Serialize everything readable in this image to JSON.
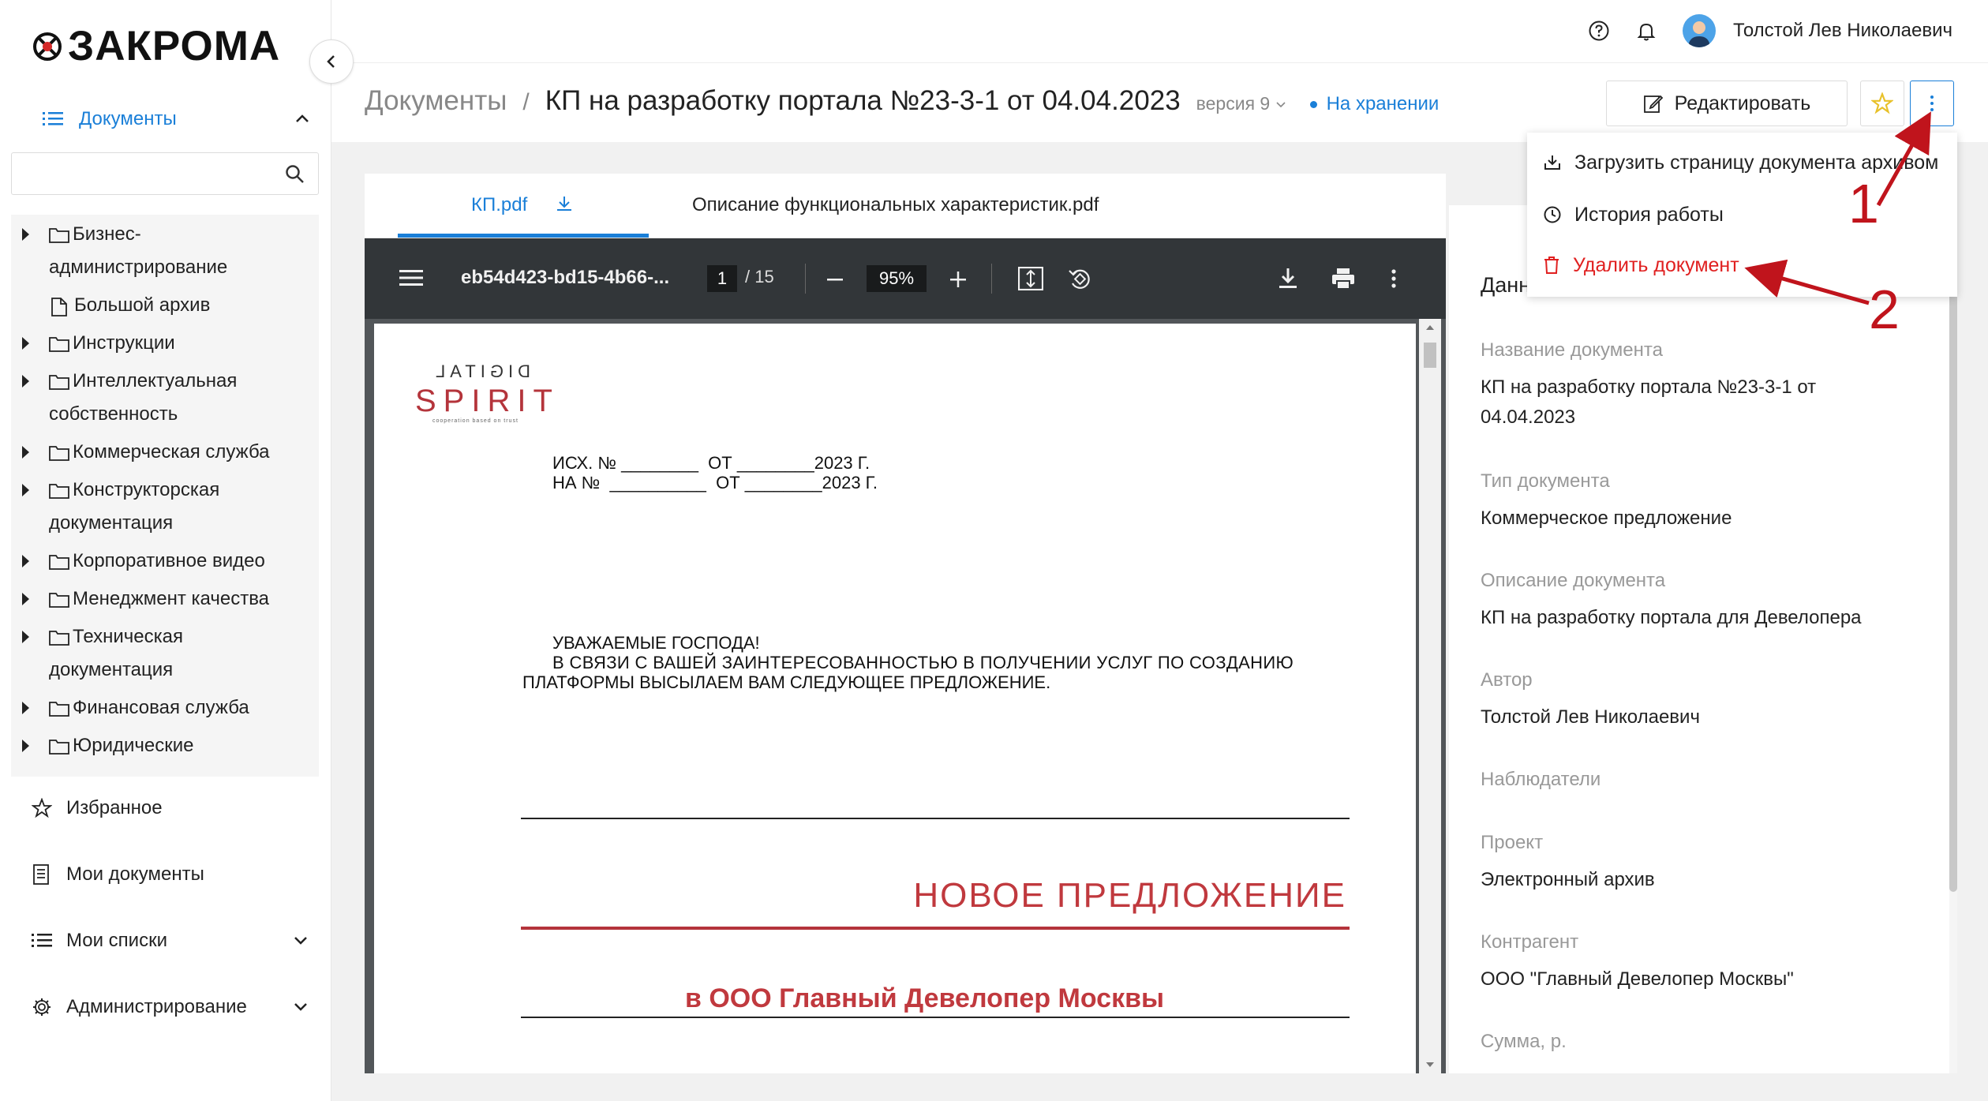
{
  "brand": {
    "name": "ЗАКРОМА"
  },
  "topbar": {
    "user_name": "Толстой Лев Николаевич",
    "icons": [
      "help-icon",
      "bell-icon"
    ]
  },
  "sidebar": {
    "documents_label": "Документы",
    "search_placeholder": "",
    "tree": [
      {
        "label": "Бизнес-администрирование",
        "line1": "Бизнес-",
        "line2": "администрирование",
        "expandable": true
      },
      {
        "label": "Большой архив",
        "expandable": false
      },
      {
        "label": "Инструкции",
        "expandable": true
      },
      {
        "label": "Интеллектуальная собственность",
        "line1": "Интеллектуальная",
        "line2": "собственность",
        "expandable": true
      },
      {
        "label": "Коммерческая служба",
        "expandable": true
      },
      {
        "label": "Конструкторская документация",
        "line1": "Конструкторская",
        "line2": "документация",
        "expandable": true
      },
      {
        "label": "Корпоративное видео",
        "expandable": true
      },
      {
        "label": "Менеджмент качества",
        "expandable": true
      },
      {
        "label": "Техническая документация",
        "line1": "Техническая",
        "line2": "документация",
        "expandable": true
      },
      {
        "label": "Финансовая служба",
        "expandable": true
      },
      {
        "label": "Юридические",
        "expandable": true
      }
    ],
    "menu": {
      "favorites": "Избранное",
      "my_documents": "Мои документы",
      "my_lists": "Мои списки",
      "admin": "Администрирование"
    }
  },
  "header": {
    "breadcrumb_root": "Документы",
    "separator": "/",
    "title": "КП на разработку портала №23-3-1 от 04.04.2023",
    "version": "версия 9",
    "status": "На хранении",
    "edit_label": "Редактировать"
  },
  "tabs": [
    {
      "label": "КП.pdf",
      "active": true
    },
    {
      "label": "Описание функциональных характеристик.pdf",
      "active": false
    }
  ],
  "pdf_viewer": {
    "filename": "eb54d423-bd15-4b66-...",
    "page": "1",
    "total_pages": "/ 15",
    "zoom": "95%"
  },
  "document": {
    "logo_top": "DIGITAL",
    "logo_main": "SPIRIT",
    "logo_sub": "cooperation based on trust",
    "line_out": "ИСХ. № ________  ОТ ________2023 Г.",
    "line_in": "НА №  __________  ОТ ________2023 Г.",
    "greeting": "УВАЖАЕМЫЕ ГОСПОДА!",
    "body1": "В СВЯЗИ С ВАШЕЙ ЗАИНТЕРЕСОВАННОСТЬЮ В ПОЛУЧЕНИИ УСЛУГ ПО СОЗДАНИЮ",
    "body2": "ПЛАТФОРМЫ ВЫСЫЛАЕМ ВАМ СЛЕДУЮЩЕЕ ПРЕДЛОЖЕНИЕ.",
    "heading": "НОВОЕ ПРЕДЛОЖЕНИЕ",
    "recipient": "в ООО Главный Девелопер Москвы"
  },
  "details": {
    "title": "Данные о документе",
    "fields": [
      {
        "label": "Название документа",
        "value": "КП на разработку портала №23-3-1 от 04.04.2023"
      },
      {
        "label": "Тип документа",
        "value": "Коммерческое предложение"
      },
      {
        "label": "Описание документа",
        "value": "КП на разработку портала для Девелопера"
      },
      {
        "label": "Автор",
        "value": "Толстой Лев Николаевич"
      },
      {
        "label": "Наблюдатели",
        "value": ""
      },
      {
        "label": "Проект",
        "value": "Электронный архив"
      },
      {
        "label": "Контрагент",
        "value": "ООО \"Главный Девелопер Москвы\""
      },
      {
        "label": "Сумма, р.",
        "value": ""
      }
    ]
  },
  "dropdown": {
    "items": [
      {
        "label": "Загрузить страницу документа архивом",
        "icon": "download-icon"
      },
      {
        "label": "История работы",
        "icon": "history-icon"
      },
      {
        "label": "Удалить документ",
        "icon": "trash-icon",
        "color": "#e02020"
      }
    ]
  },
  "annotations": {
    "marker1": "1",
    "marker2": "2",
    "color": "#c0141c"
  },
  "colors": {
    "accent": "#1a7fd8",
    "danger": "#e02020",
    "brand_red": "#b4343b"
  }
}
